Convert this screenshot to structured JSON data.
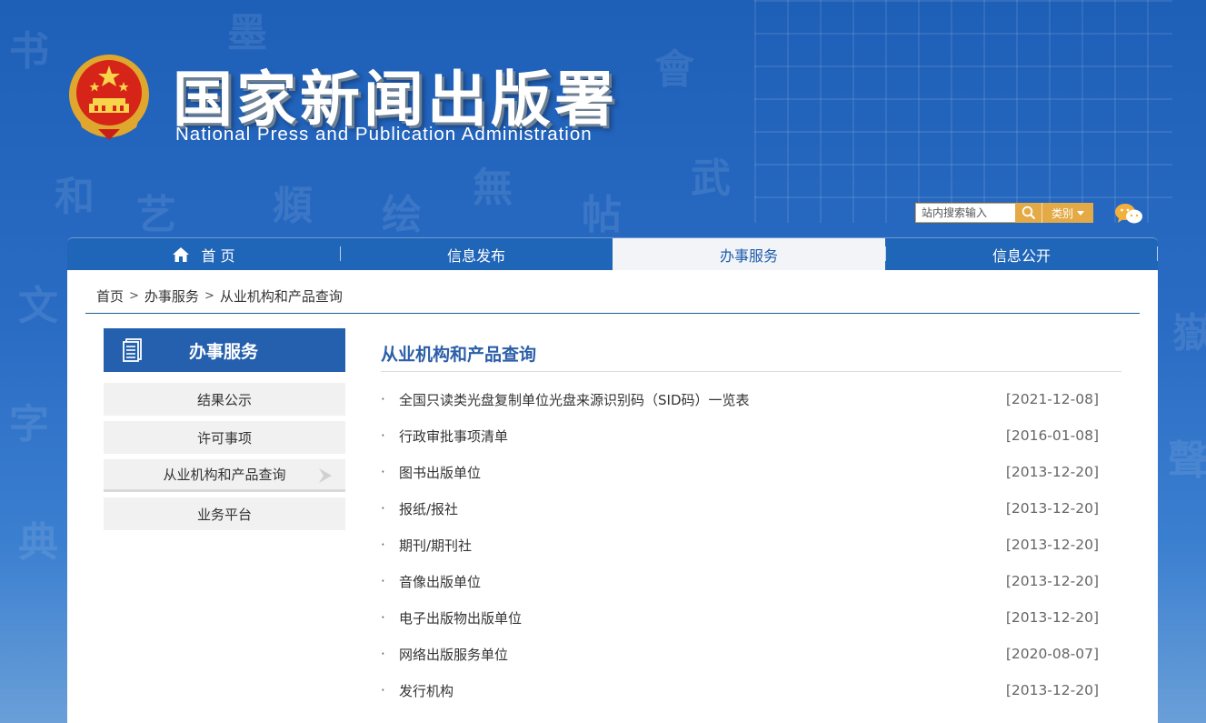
{
  "site": {
    "title_cn": "国家新闻出版署",
    "title_en": "National  Press and Publication Administration"
  },
  "search": {
    "placeholder": "站内搜索输入",
    "category_label": "类别"
  },
  "nav": {
    "items": [
      {
        "label": "首 页"
      },
      {
        "label": "信息发布"
      },
      {
        "label": "办事服务"
      },
      {
        "label": "信息公开"
      }
    ],
    "active_index": 2
  },
  "breadcrumb": {
    "items": [
      "首页",
      "办事服务",
      "从业机构和产品查询"
    ],
    "separator": ">"
  },
  "sidebar": {
    "title": "办事服务",
    "items": [
      {
        "label": "结果公示"
      },
      {
        "label": "许可事项"
      },
      {
        "label": "从业机构和产品查询"
      },
      {
        "label": "业务平台"
      }
    ]
  },
  "content": {
    "title": "从业机构和产品查询",
    "bullet": "·",
    "items": [
      {
        "title": "全国只读类光盘复制单位光盘来源识别码（SID码）一览表",
        "date": "[2021-12-08]"
      },
      {
        "title": "行政审批事项清单",
        "date": "[2016-01-08]"
      },
      {
        "title": "图书出版单位",
        "date": "[2013-12-20]"
      },
      {
        "title": "报纸/报社",
        "date": "[2013-12-20]"
      },
      {
        "title": "期刊/期刊社",
        "date": "[2013-12-20]"
      },
      {
        "title": "音像出版单位",
        "date": "[2013-12-20]"
      },
      {
        "title": "电子出版物出版单位",
        "date": "[2013-12-20]"
      },
      {
        "title": "网络出版服务单位",
        "date": "[2020-08-07]"
      },
      {
        "title": "发行机构",
        "date": "[2013-12-20]"
      }
    ]
  },
  "colors": {
    "brand_blue": "#2460ad",
    "title_blue": "#2c5fa8",
    "search_gold": "#e3aa46"
  }
}
